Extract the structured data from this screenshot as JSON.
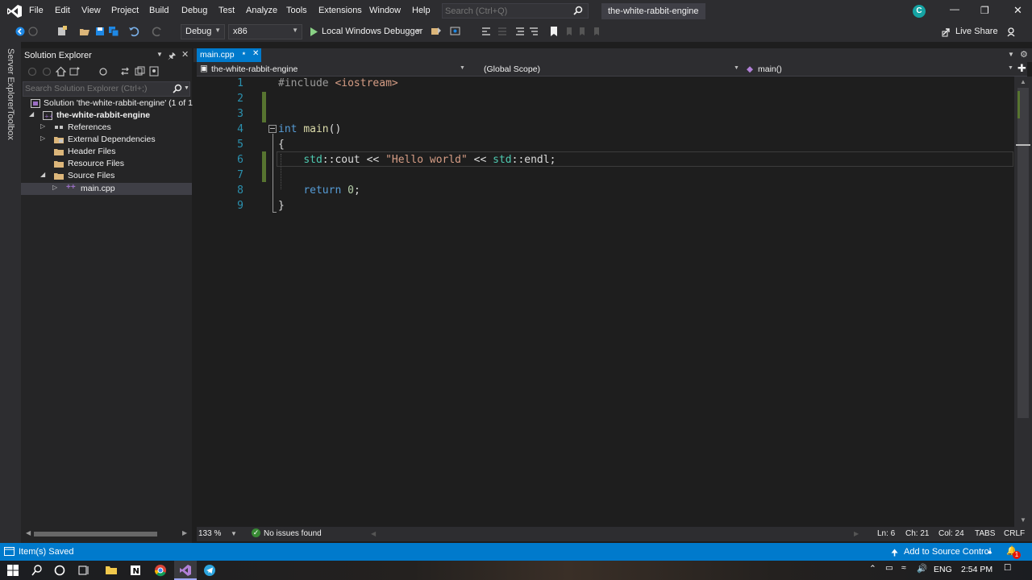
{
  "menu": {
    "items": [
      "File",
      "Edit",
      "View",
      "Project",
      "Build",
      "Debug",
      "Test",
      "Analyze",
      "Tools",
      "Extensions",
      "Window",
      "Help"
    ],
    "search_placeholder": "Search (Ctrl+Q)",
    "solution_title": "the-white-rabbit-engine",
    "account_initial": "C"
  },
  "toolbar": {
    "config": "Debug",
    "platform": "x86",
    "debugger": "Local Windows Debugger",
    "live_share": "Live Share"
  },
  "sidetabs": {
    "server_explorer": "Server Explorer",
    "toolbox": "Toolbox"
  },
  "solution_explorer": {
    "title": "Solution Explorer",
    "search_placeholder": "Search Solution Explorer (Ctrl+;)",
    "tree": [
      {
        "label": "Solution 'the-white-rabbit-engine' (1 of 1",
        "level": 0,
        "expanded": true
      },
      {
        "label": "the-white-rabbit-engine",
        "level": 1,
        "expanded": true,
        "bold": true
      },
      {
        "label": "References",
        "level": 2,
        "expanded": false
      },
      {
        "label": "External Dependencies",
        "level": 2,
        "expanded": false
      },
      {
        "label": "Header Files",
        "level": 2
      },
      {
        "label": "Resource Files",
        "level": 2
      },
      {
        "label": "Source Files",
        "level": 2,
        "expanded": true
      },
      {
        "label": "main.cpp",
        "level": 3,
        "expanded": false,
        "selected": true
      }
    ]
  },
  "editor": {
    "tab_label": "main.cpp",
    "project_scope": "the-white-rabbit-engine",
    "global_scope": "(Global Scope)",
    "member_scope": "main()",
    "line_numbers": [
      "1",
      "2",
      "3",
      "4",
      "5",
      "6",
      "7",
      "8",
      "9"
    ],
    "lines": [
      "#include <iostream>",
      "",
      "",
      "int main()",
      "{",
      "    std::cout << \"Hello world\" << std::endl;",
      "",
      "    return 0;",
      "}"
    ],
    "zoom": "133 %",
    "issues": "No issues found",
    "ln": "Ln: 6",
    "ch": "Ch: 21",
    "col": "Col: 24",
    "tabs": "TABS",
    "eol": "CRLF"
  },
  "statusbar": {
    "message": "Item(s) Saved",
    "source_control": "Add to Source Control",
    "notification_count": "1"
  },
  "taskbar": {
    "lang": "ENG",
    "time": "2:54 PM"
  },
  "colors": {
    "accent": "#007acc",
    "chrome": "#2d2d30",
    "editor_bg": "#1e1e1e",
    "line_number": "#2b91af",
    "keyword": "#569cd6",
    "string": "#d69d85",
    "change_bar": "#577430"
  }
}
